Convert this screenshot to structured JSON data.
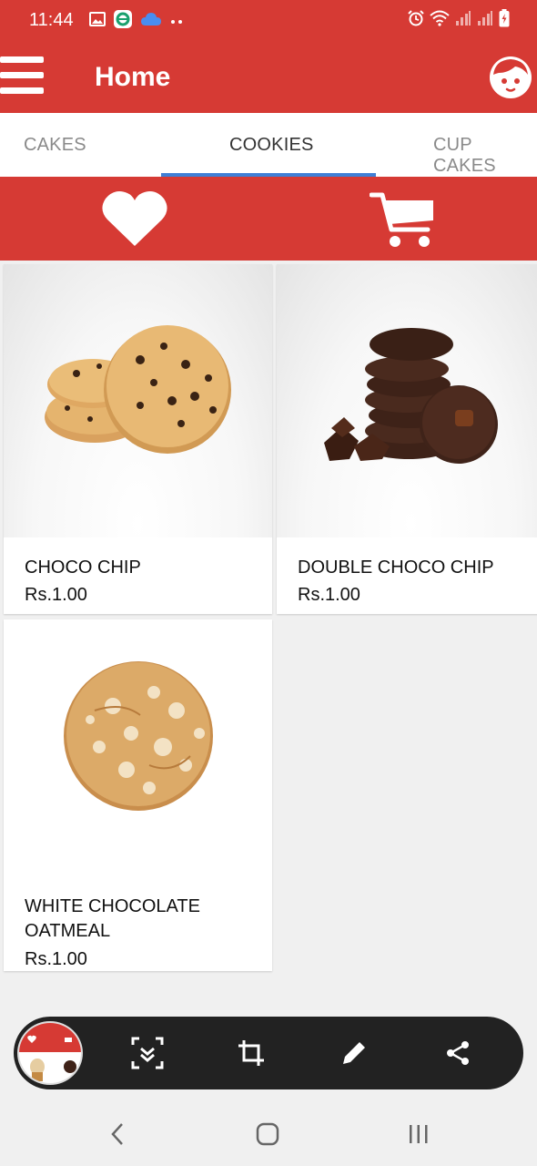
{
  "status_bar": {
    "time": "11:44",
    "left_icons": [
      "gallery-icon",
      "app-notification-icon",
      "cloud-icon",
      "more-dots-icon"
    ],
    "right_icons": [
      "alarm-icon",
      "wifi-icon",
      "signal-icon",
      "signal-icon",
      "battery-charging-icon"
    ]
  },
  "app_bar": {
    "title": "Home",
    "menu_icon": "hamburger-menu-icon",
    "avatar_icon": "profile-face-icon"
  },
  "tabs": [
    {
      "label": "CAKES",
      "active": false
    },
    {
      "label": "COOKIES",
      "active": true
    },
    {
      "label": "CUP CAKES",
      "active": false
    }
  ],
  "action_bar": {
    "favorites_icon": "heart-icon",
    "cart_icon": "shopping-cart-icon"
  },
  "products": [
    {
      "name": "CHOCO CHIP",
      "price": "Rs.1.00",
      "image": "choco-chip-cookie-image"
    },
    {
      "name": "DOUBLE CHOCO CHIP",
      "price": "Rs.1.00",
      "image": "double-choco-chip-cookie-image"
    },
    {
      "name": "WHITE CHOCOLATE OATMEAL",
      "price": "Rs.1.00",
      "image": "white-chocolate-oatmeal-cookie-image"
    }
  ],
  "screenshot_toolbar": {
    "icons": [
      "screenshot-thumbnail",
      "scroll-capture-icon",
      "crop-icon",
      "edit-pencil-icon",
      "share-icon"
    ]
  },
  "nav_bar": {
    "icons": [
      "back-icon",
      "home-icon",
      "recents-icon"
    ]
  },
  "colors": {
    "brand_red": "#d63a34",
    "tab_indicator": "#3f7fd6",
    "toolbar_bg": "#222222",
    "page_bg": "#f0f0f0"
  }
}
